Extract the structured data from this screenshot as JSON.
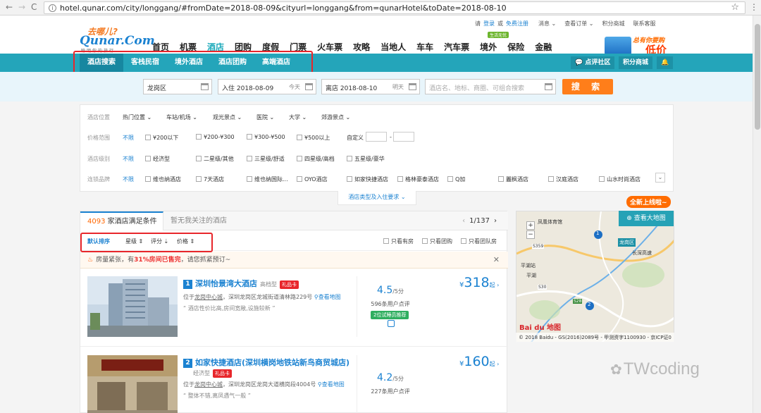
{
  "browser": {
    "url": "hotel.qunar.com/city/longgang/#fromDate=2018-08-09&cityurl=longgang&from=qunarHotel&toDate=2018-08-10",
    "back": "←",
    "forward": "→",
    "reload": "C",
    "star": "☆",
    "menu": "⋮",
    "info": "i"
  },
  "header": {
    "logo_slogan": "去哪儿?",
    "logo_text": "Qunar.Com",
    "logo_sub": "聪明你的旅行",
    "userbar": {
      "please": "请",
      "login": "登录",
      "or": "或",
      "register": "免费注册",
      "messages": "消息 ⌄",
      "orders": "查看订单 ⌄",
      "points": "积分商城",
      "service": "联系客服"
    },
    "nav": [
      "首页",
      "机票",
      "酒店",
      "团购",
      "度假",
      "门票",
      "火车票",
      "攻略",
      "当地人",
      "车车",
      "汽车票",
      "境外",
      "保险",
      "金融"
    ],
    "nav_active": 2,
    "new_badge": "生活无忧",
    "promo_t1": "总有你要购",
    "promo_t2": "低价"
  },
  "subnav": {
    "items": [
      "酒店搜索",
      "客栈民宿",
      "境外酒店",
      "酒店团购",
      "高端酒店"
    ],
    "active": 0,
    "right": [
      "点评社区",
      "积分商城",
      "🔔"
    ]
  },
  "search": {
    "city": "龙岗区",
    "checkin": "入住 2018-08-09",
    "checkin_day": "今天",
    "checkout": "离店 2018-08-10",
    "checkout_day": "明天",
    "keyword_placeholder": "酒店名、地标、商圈、可组合搜索",
    "button": "搜 索"
  },
  "filters": {
    "location": {
      "label": "酒店位置",
      "opts": [
        "热门位置 ⌄",
        "车站/机场 ⌄",
        "观光景点 ⌄",
        "医院 ⌄",
        "大学 ⌄",
        "郊游景点 ⌄"
      ]
    },
    "price": {
      "label": "价格范围",
      "unlimited": "不限",
      "opts": [
        "¥200以下",
        "¥200-¥300",
        "¥300-¥500",
        "¥500以上"
      ],
      "custom": "自定义",
      "dash": "-"
    },
    "grade": {
      "label": "酒店级别",
      "unlimited": "不限",
      "opts": [
        "经济型",
        "二星级/其他",
        "三星级/舒适",
        "四星级/高档",
        "五星级/豪华"
      ]
    },
    "brand": {
      "label": "连锁品牌",
      "unlimited": "不限",
      "opts": [
        "维也纳酒店",
        "7天酒店",
        "维也纳国际...",
        "OYO酒店",
        "如家快捷酒店",
        "格林豪泰酒店",
        "Q加",
        "麗枫酒店",
        "汉庭酒店",
        "山水时尚酒店"
      ],
      "expand": "⌄"
    },
    "more": "酒店类型及入住要求 ⌄"
  },
  "results": {
    "count": "4093",
    "count_suffix": " 家酒店满足条件",
    "tab2": "暂无我关注的酒店",
    "pager": {
      "prev": "‹",
      "page": "1/137",
      "next": "›"
    },
    "sort": [
      "默认排序",
      "星级 ⇕",
      "评分 ⇣",
      "价格 ⇕"
    ],
    "checks": [
      "只看有房",
      "只看团购",
      "只看团队房"
    ],
    "alert": {
      "fire": "♨",
      "pre": "房量紧张，有",
      "pct": "31%房间已售完",
      "post": "，请您抓紧预订~",
      "close": "✕"
    },
    "hotels": [
      {
        "idx": "1",
        "name": "深圳怡景湾大酒店",
        "grade": "高档型",
        "gift": "礼品卡",
        "addr_pre": "位于",
        "addr_area": "龙岗中心城",
        "addr_post": "，深圳龙岗区龙城街道清林路229号",
        "map": "查看地图",
        "comment": "“ 酒店性价比高,房间宽敞,设施较新 ”",
        "score": "4.5",
        "score_unit": "/5分",
        "reviews": "596条用户点评",
        "member": "2位试睡员推荐",
        "price_sym": "¥",
        "price": "318",
        "price_qi": "起 ›"
      },
      {
        "idx": "2",
        "name": "如家快捷酒店(深圳横岗地铁站新鸟商贸城店)",
        "grade": "经济型",
        "gift": "礼品卡",
        "addr_pre": "位于",
        "addr_area": "龙岗中心城",
        "addr_post": "，深圳龙岗区龙岗大道横岗段4004号",
        "map": "查看地图",
        "comment": "“ 整体不错,离凤遇气一般 ”",
        "score": "4.2",
        "score_unit": "/5分",
        "reviews": "227条用户点评",
        "price_sym": "¥",
        "price": "160",
        "price_qi": "起 ›"
      }
    ]
  },
  "map": {
    "tag": "全新上线啦~",
    "button": "查看大地图",
    "labels": [
      "凤凰体育馆",
      "龙岗区",
      "长深高速",
      "平湖站",
      "S359",
      "S28",
      "平湖",
      "S30"
    ],
    "pins": [
      "1",
      "2"
    ],
    "zoom_in": "+",
    "zoom_out": "−",
    "baidu": "Bai du 地图",
    "footer": "© 2018 Baidu - GS(2016)2089号 - 甲测资字1100930 - 京ICP证0"
  },
  "watermark": "TWcoding",
  "colors": {
    "teal": "#24a5ba",
    "blue": "#1b82d1",
    "orange": "#ff7e1a",
    "red_box": "#e8262b"
  }
}
